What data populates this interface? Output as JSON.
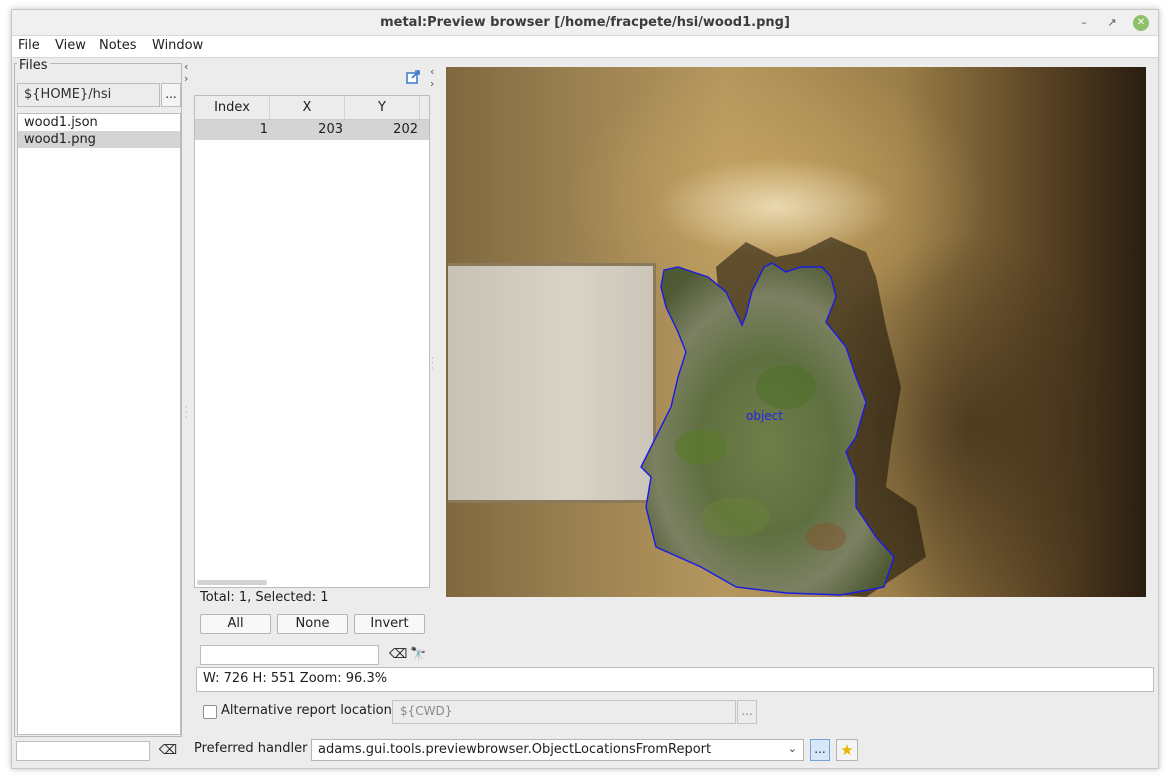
{
  "window": {
    "title": "metal:Preview browser [/home/fracpete/hsi/wood1.png]",
    "minimize_glyph": "–",
    "maximize_glyph": "↗",
    "close_glyph": "✕"
  },
  "menubar": {
    "items": [
      {
        "label": "File"
      },
      {
        "label": "View"
      },
      {
        "label": "Notes"
      },
      {
        "label": "Window"
      }
    ]
  },
  "files": {
    "legend": "Files",
    "directory": "${HOME}/hsi",
    "browse_label": "...",
    "items": [
      {
        "name": "wood1.json",
        "selected": false
      },
      {
        "name": "wood1.png",
        "selected": true
      }
    ],
    "filter_value": "",
    "clear_glyph": "⌫"
  },
  "locations_table": {
    "columns": [
      "Index",
      "X",
      "Y"
    ],
    "rows": [
      {
        "index": "1",
        "x": "203",
        "y": "202"
      }
    ],
    "status": "Total: 1, Selected: 1",
    "buttons": {
      "all": "All",
      "none": "None",
      "invert": "Invert"
    },
    "search_value": "",
    "clear_glyph": "⌫",
    "find_glyph": "🔭"
  },
  "image": {
    "object_label": "object",
    "outline_color": "#1a1ae6"
  },
  "info_bar": {
    "text": "W: 726  H: 551  Zoom: 96.3%"
  },
  "alt_report": {
    "label": "Alternative report location",
    "checked": false,
    "value": "${CWD}",
    "browse_label": "..."
  },
  "handler": {
    "label": "Preferred handler",
    "value": "adams.gui.tools.previewbrowser.ObjectLocationsFromReport",
    "browse_label": "...",
    "favorite_glyph": "★",
    "dropdown_glyph": "⌄"
  },
  "colors": {
    "selection": "#d4d4d4",
    "accent_button": "#d6e6fb",
    "favorite_star": "#e6b800"
  }
}
